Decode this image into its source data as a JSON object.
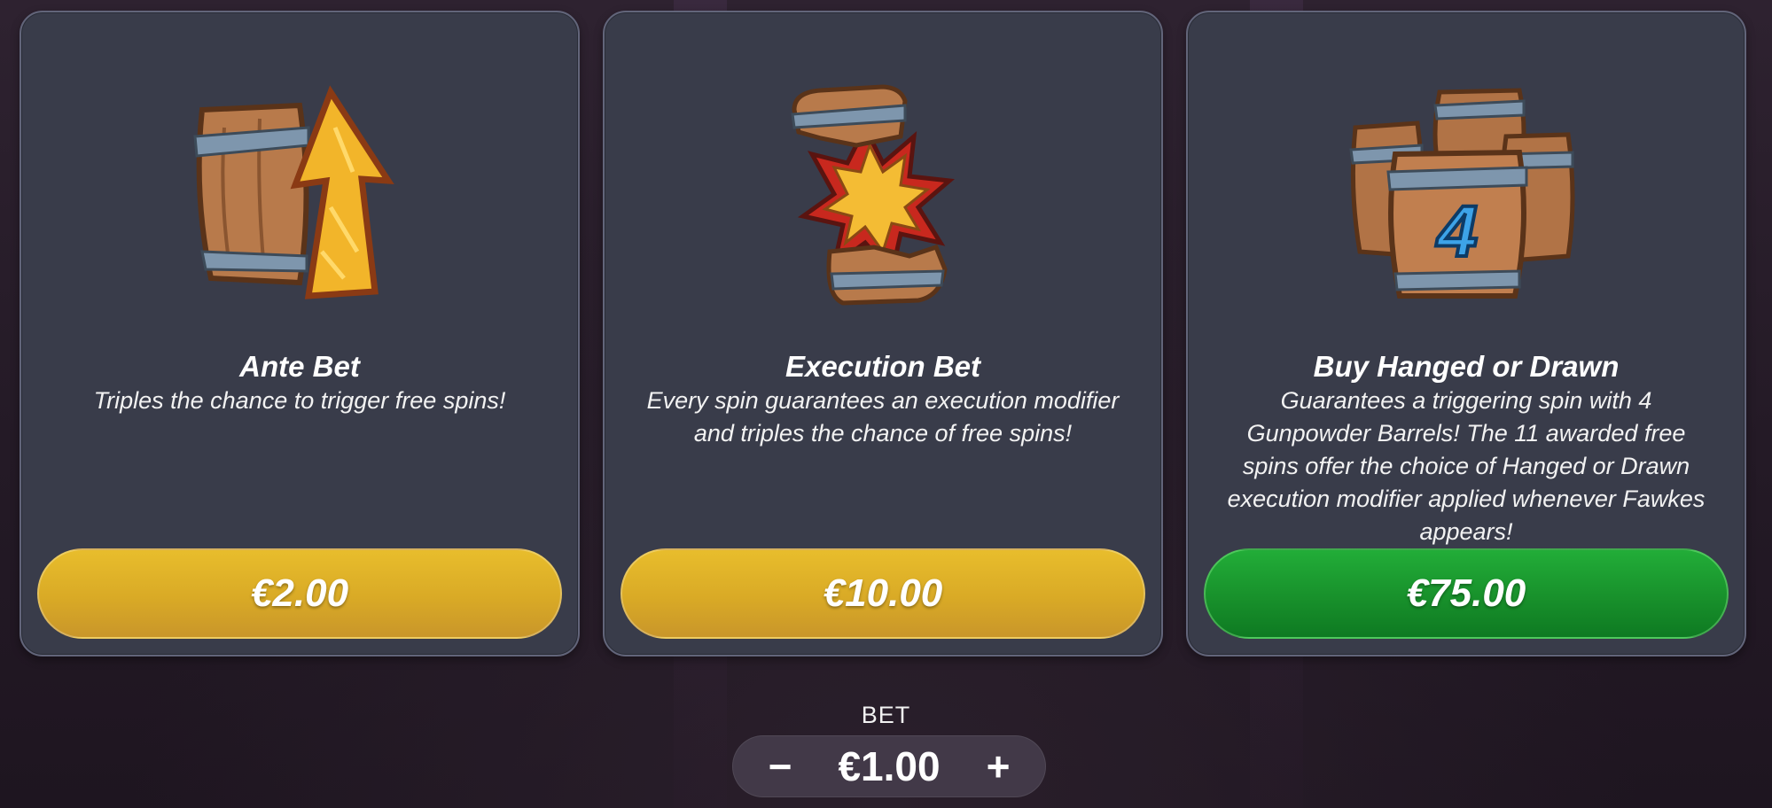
{
  "colors": {
    "card_bg": "#393c4a",
    "card_border": "#62657a",
    "gold_button": "#ddb028",
    "green_button": "#1a9a2f",
    "background": "#2a1f2b"
  },
  "cards": [
    {
      "icon": "barrel-up-arrow-icon",
      "title": "Ante Bet",
      "description": "Triples the chance to trigger free spins!",
      "price": "€2.00",
      "button_color": "gold"
    },
    {
      "icon": "broken-barrel-explosion-icon",
      "title": "Execution Bet",
      "description": "Every spin guarantees an execution modifier and triples the chance of free spins!",
      "price": "€10.00",
      "button_color": "gold"
    },
    {
      "icon": "four-barrels-icon",
      "title": "Buy Hanged or Drawn",
      "description": "Guarantees a triggering spin with 4 Gunpowder Barrels! The 11 awarded free spins offer the choice of Hanged or Drawn execution modifier applied whenever Fawkes appears!",
      "price": "€75.00",
      "button_color": "green",
      "icon_number": "4"
    }
  ],
  "bet": {
    "label": "BET",
    "value": "€1.00",
    "decrease": "−",
    "increase": "+"
  }
}
